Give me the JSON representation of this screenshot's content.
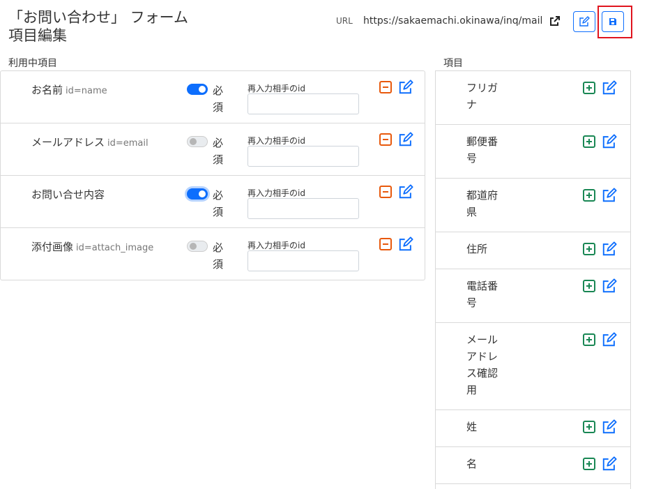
{
  "header": {
    "title_line1": "「お問い合わせ」 フォーム",
    "title_line2": "項目編集",
    "url_label": "URL",
    "url_value": "https://sakaemachi.okinawa/inq/mail"
  },
  "left": {
    "section_label": "利用中項目",
    "reinput_label": "再入力相手のid",
    "required_label": "必須",
    "items": [
      {
        "name": "お名前",
        "id_text": "id=name",
        "required": true
      },
      {
        "name": "メールアドレス",
        "id_text": "id=email",
        "required": false
      },
      {
        "name": "お問い合せ内容",
        "id_text": "",
        "required": true
      },
      {
        "name": "添付画像",
        "id_text": "id=attach_image",
        "required": false
      }
    ]
  },
  "right": {
    "section_label": "項目",
    "items": [
      {
        "name": "フリガナ"
      },
      {
        "name": "郵便番号"
      },
      {
        "name": "都道府県"
      },
      {
        "name": "住所"
      },
      {
        "name": "電話番号"
      },
      {
        "name": "メールアドレス確認用"
      },
      {
        "name": "姓"
      },
      {
        "name": "名"
      }
    ]
  },
  "colors": {
    "primary": "#0d6efd",
    "remove": "#e8590c",
    "add": "#198754",
    "highlight": "#e0141e"
  },
  "icons": [
    "external-link-icon",
    "edit-icon",
    "save-icon",
    "minus-square-icon",
    "plus-square-icon"
  ]
}
